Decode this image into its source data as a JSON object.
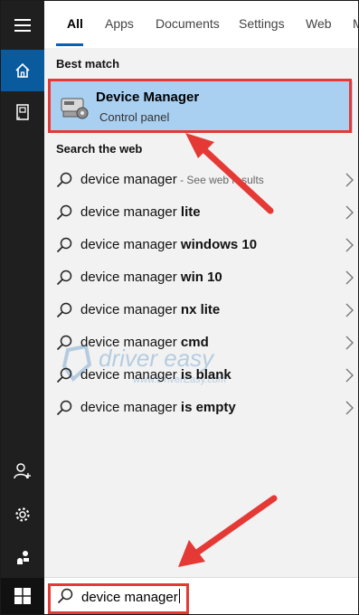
{
  "tabs": [
    "All",
    "Apps",
    "Documents",
    "Settings",
    "Web",
    "M"
  ],
  "best_match": {
    "section_label": "Best match",
    "title": "Device Manager",
    "subtitle": "Control panel",
    "icon": "device-manager-icon"
  },
  "web": {
    "section_label": "Search the web",
    "results": [
      {
        "prefix": "device manager",
        "bold": "",
        "meta": " - See web results"
      },
      {
        "prefix": "device manager ",
        "bold": "lite",
        "meta": ""
      },
      {
        "prefix": "device manager ",
        "bold": "windows 10",
        "meta": ""
      },
      {
        "prefix": "device manager ",
        "bold": "win 10",
        "meta": ""
      },
      {
        "prefix": "device manager ",
        "bold": "nx lite",
        "meta": ""
      },
      {
        "prefix": "device manager ",
        "bold": "cmd",
        "meta": ""
      },
      {
        "prefix": "device manager ",
        "bold": "is blank",
        "meta": ""
      },
      {
        "prefix": "device manager ",
        "bold": "is empty",
        "meta": ""
      }
    ]
  },
  "watermark": {
    "brand": "driver easy",
    "url": "www.DriverEasy.com"
  },
  "search": {
    "value": "device manager"
  },
  "colors": {
    "accent": "#0a5fb4",
    "highlight": "#a9cff1",
    "annotation": "#e53935"
  }
}
